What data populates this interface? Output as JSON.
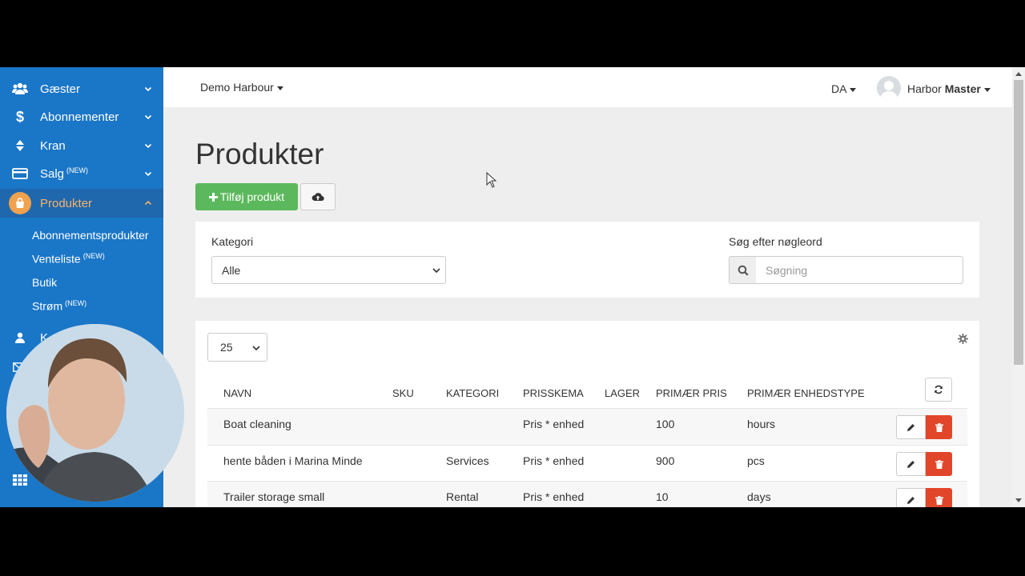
{
  "sidebar": {
    "items": [
      {
        "label": "Gæster",
        "icon": "users-icon",
        "expanded": false
      },
      {
        "label": "Abonnementer",
        "icon": "dollar-icon",
        "expanded": false
      },
      {
        "label": "Kran",
        "icon": "crane-updown-icon",
        "expanded": false
      },
      {
        "label": "Salg",
        "badge": "(NEW)",
        "icon": "credit-card-icon",
        "expanded": false
      },
      {
        "label": "Produkter",
        "icon": "shopping-bag-icon",
        "expanded": true,
        "active": true
      }
    ],
    "subitems": [
      {
        "label": "Abonnementsprodukter"
      },
      {
        "label": "Venteliste",
        "badge": "(NEW)"
      },
      {
        "label": "Butik"
      },
      {
        "label": "Strøm",
        "badge": "(NEW)"
      }
    ],
    "partial_item": {
      "label": "K",
      "icon": "user-icon"
    },
    "colors": {
      "background": "#1a76c7",
      "active_accent": "#f0a24f"
    }
  },
  "topbar": {
    "org_label": "Demo Harbour",
    "lang_label": "DA",
    "user_first": "Harbor",
    "user_last": "Master"
  },
  "page": {
    "title": "Produkter",
    "add_button_label": "Tilføj produkt",
    "add_icon": "plus-icon",
    "upload_icon": "cloud-upload-icon"
  },
  "filters": {
    "category_label": "Kategori",
    "category_value": "Alle",
    "search_label": "Søg efter nøgleord",
    "search_placeholder": "Søgning"
  },
  "table": {
    "page_size": "25",
    "headers": [
      "NAVN",
      "SKU",
      "KATEGORI",
      "PRISSKEMA",
      "LAGER",
      "PRIMÆR PRIS",
      "PRIMÆR ENHEDSTYPE"
    ],
    "rows": [
      {
        "name": "Boat cleaning",
        "sku": "",
        "category": "",
        "price_scheme": "Pris * enhed",
        "stock": "",
        "price": "100",
        "unit": "hours"
      },
      {
        "name": "hente båden i Marina Minde",
        "sku": "",
        "category": "Services",
        "price_scheme": "Pris * enhed",
        "stock": "",
        "price": "900",
        "unit": "pcs"
      },
      {
        "name": "Trailer storage small",
        "sku": "",
        "category": "Rental",
        "price_scheme": "Pris * enhed",
        "stock": "",
        "price": "10",
        "unit": "days"
      }
    ]
  },
  "colors": {
    "add_button": "#5cb85c",
    "delete_button": "#e2462a"
  }
}
